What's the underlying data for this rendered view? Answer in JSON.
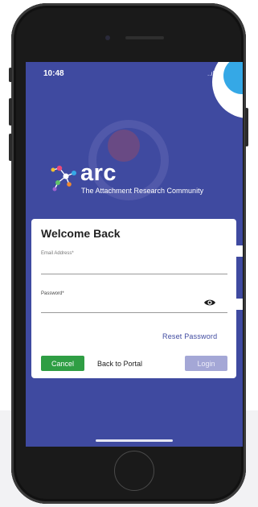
{
  "status_bar": {
    "time": "10:48",
    "signal_icons": "..ıl ≈ ▭"
  },
  "brand": {
    "logo_icon": "molecule-node-icon",
    "name": "arc",
    "tagline": "The Attachment Research Community",
    "colors": {
      "primary": "#3f4aa0",
      "success": "#2f9e44",
      "accent": "#35a8e6"
    }
  },
  "login_card": {
    "title": "Welcome Back",
    "email": {
      "label": "Email Address*",
      "value": ""
    },
    "password": {
      "label": "Password*",
      "value": "",
      "toggle_icon": "eye-icon"
    },
    "reset_password_label": "Reset Password",
    "cancel_label": "Cancel",
    "back_label": "Back to Portal",
    "login_label": "Login"
  }
}
